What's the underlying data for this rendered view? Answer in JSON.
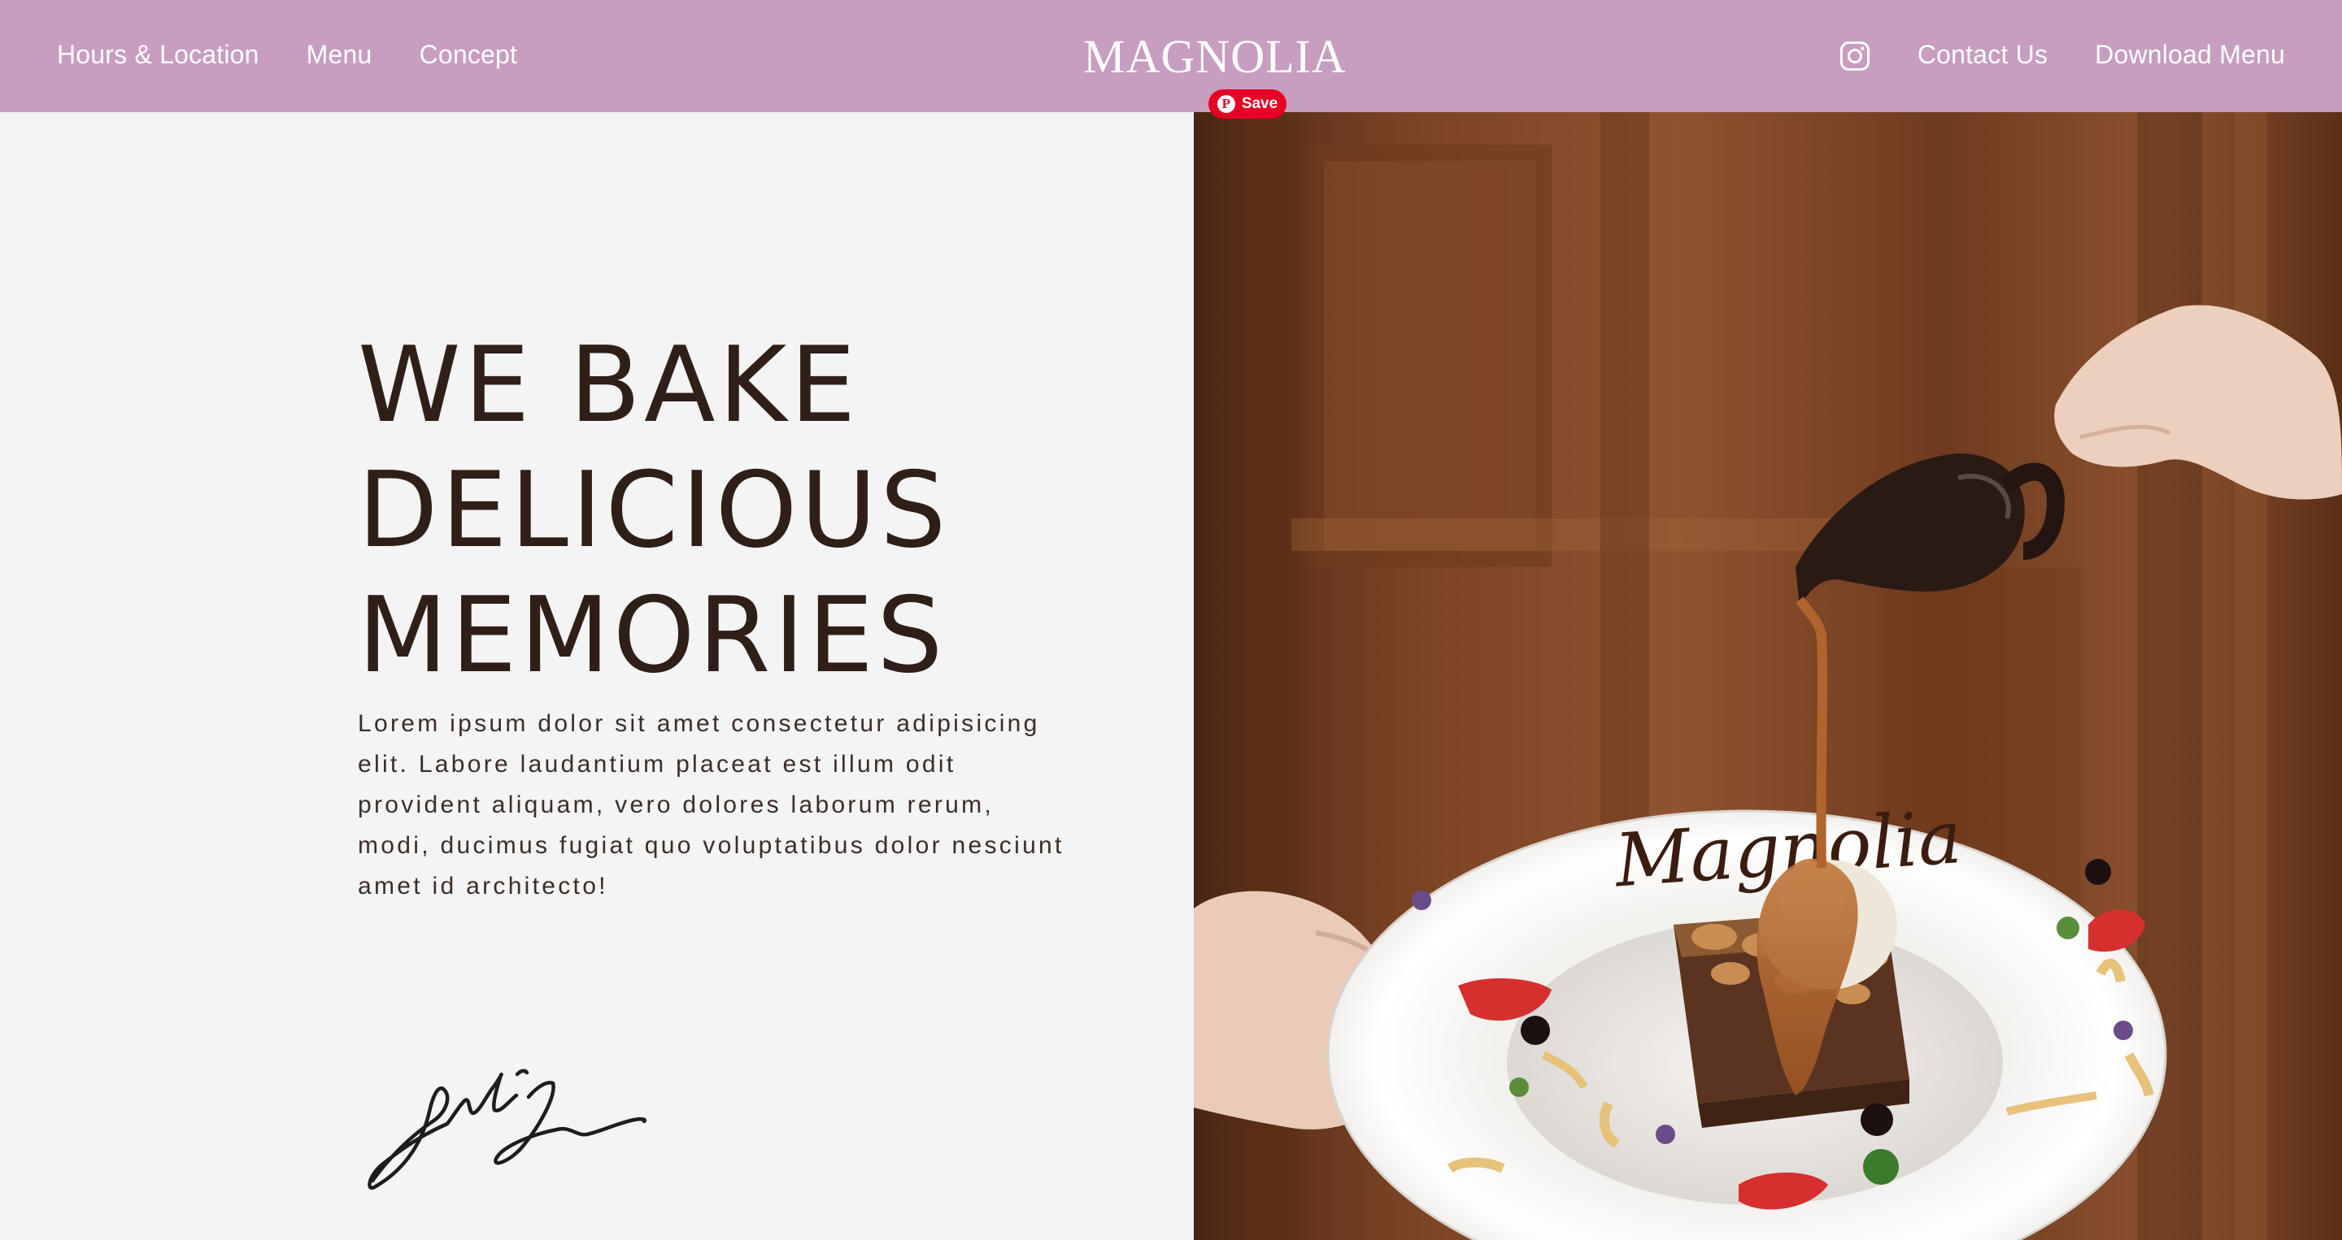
{
  "nav": {
    "left": [
      "Hours & Location",
      "Menu",
      "Concept"
    ],
    "brand": "MAGNOLIA",
    "instagram_icon": "instagram-icon",
    "right": [
      "Contact Us",
      "Download Menu"
    ]
  },
  "pinterest": {
    "label": "Save",
    "logo": "P"
  },
  "hero": {
    "headline": [
      "WE BAKE",
      "DELICIOUS",
      "MEMORIES"
    ],
    "body": "Lorem ipsum dolor sit amet consectetur adipisicing elit. Labore laudantium placeat est illum odit provident aliquam, vero dolores laborum rerum, modi, ducimus fugiat quo voluptatibus dolor nesciunt amet id architecto!",
    "signature_icon": "signature-icon",
    "image_icon": "dessert-photo",
    "plate_text": "Magnolia"
  },
  "colors": {
    "navbar": "#c79dc0",
    "headline": "#2f1f18",
    "background": "#f4f4f4",
    "pinterest": "#e60023"
  }
}
